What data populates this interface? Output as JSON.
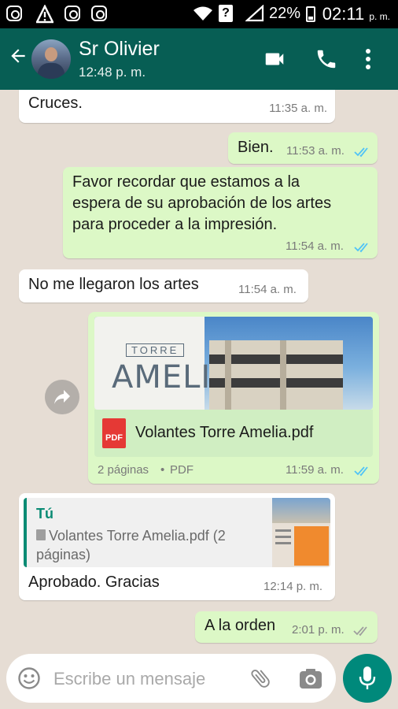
{
  "status_bar": {
    "battery": "22%",
    "time": "02:11",
    "ampm": "p. m."
  },
  "header": {
    "contact_name": "Sr Olivier",
    "last_seen": "12:48 p. m."
  },
  "messages": [
    {
      "direction": "in",
      "text": "Cruces.",
      "time": "11:35 a. m."
    },
    {
      "direction": "out",
      "text": "Bien.",
      "time": "11:53 a. m.",
      "status": "read"
    },
    {
      "direction": "out",
      "lines": [
        "Favor recordar que estamos a la",
        "espera de su aprobación de los artes",
        "para proceder a la impresión."
      ],
      "time": "11:54 a. m.",
      "status": "read"
    },
    {
      "direction": "in",
      "text": "No me llegaron los artes",
      "time": "11:54 a. m."
    },
    {
      "direction": "out",
      "type": "document",
      "preview_title_small": "TORRE",
      "preview_title": "AMELIA",
      "file_name": "Volantes Torre Amelia.pdf",
      "file_icon": "pdf-file-icon",
      "file_icon_label": "PDF",
      "pages": "2 páginas",
      "file_type": "PDF",
      "time": "11:59 a. m.",
      "status": "read"
    },
    {
      "direction": "in",
      "quote_author": "Tú",
      "quote_lines": [
        "Volantes Torre Amelia.pdf (2",
        "páginas)"
      ],
      "text": "Aprobado.  Gracias",
      "time": "12:14 p. m."
    },
    {
      "direction": "out",
      "text": "A la orden",
      "time": "2:01 p. m.",
      "status": "delivered"
    }
  ],
  "input": {
    "placeholder": "Escribe un mensaje"
  },
  "colors": {
    "header": "#075e54",
    "outgoing_bubble": "#dcf8c6",
    "incoming_bubble": "#ffffff",
    "read_ticks": "#4fc3f7",
    "delivered_ticks": "#9e9e9e",
    "mic_button": "#00897b",
    "pdf_icon": "#e53935",
    "quote_bar": "#0a8b74"
  }
}
